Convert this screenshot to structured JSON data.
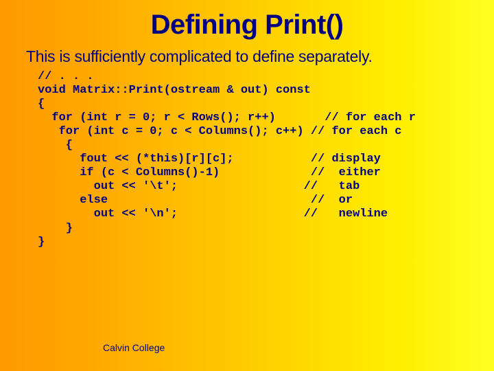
{
  "title": "Defining Print()",
  "subtitle": "This is sufficiently complicated to define separately.",
  "code": "// . . .\nvoid Matrix::Print(ostream & out) const\n{\n  for (int r = 0; r < Rows(); r++)       // for each r\n   for (int c = 0; c < Columns(); c++) // for each c\n    {\n      fout << (*this)[r][c];           // display\n      if (c < Columns()-1)             //  either\n        out << '\\t';                  //   tab\n      else                             //  or\n        out << '\\n';                  //   newline\n    }\n}",
  "footer": "Calvin College"
}
